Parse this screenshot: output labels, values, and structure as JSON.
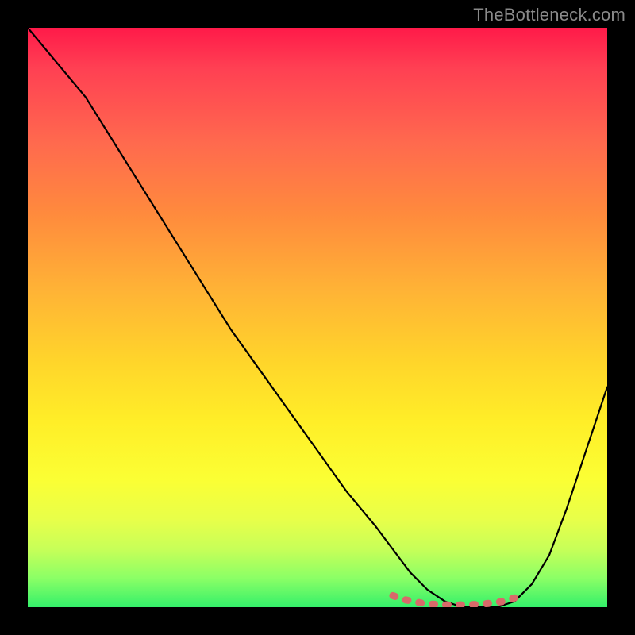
{
  "watermark": "TheBottleneck.com",
  "chart_data": {
    "type": "line",
    "title": "",
    "xlabel": "",
    "ylabel": "",
    "xlim": [
      0,
      100
    ],
    "ylim": [
      0,
      100
    ],
    "grid": false,
    "legend_position": "none",
    "background_gradient": {
      "top": "#ff1a49",
      "middle": "#ffd62a",
      "bottom": "#34f06a"
    },
    "series": [
      {
        "name": "bottleneck-curve",
        "color": "#000000",
        "x": [
          0,
          5,
          10,
          15,
          20,
          25,
          30,
          35,
          40,
          45,
          50,
          55,
          60,
          63,
          66,
          69,
          72,
          75,
          78,
          81,
          84,
          87,
          90,
          93,
          96,
          100
        ],
        "y": [
          100,
          94,
          88,
          80,
          72,
          64,
          56,
          48,
          41,
          34,
          27,
          20,
          14,
          10,
          6,
          3,
          1,
          0,
          0,
          0,
          1,
          4,
          9,
          17,
          26,
          38
        ]
      },
      {
        "name": "highlight-segment",
        "color": "#d86a6a",
        "thick": true,
        "x": [
          63,
          65,
          68,
          70,
          72,
          74,
          76,
          78,
          80,
          82,
          84
        ],
        "y": [
          2.0,
          1.3,
          0.7,
          0.5,
          0.4,
          0.4,
          0.4,
          0.5,
          0.7,
          1.0,
          1.6
        ]
      }
    ]
  }
}
